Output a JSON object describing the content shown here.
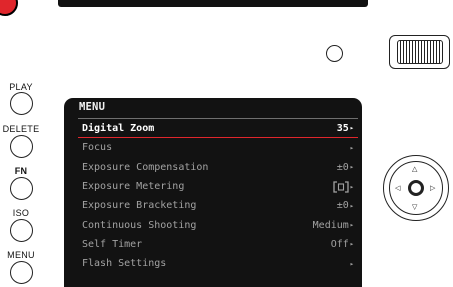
{
  "side_buttons": [
    {
      "label": "PLAY"
    },
    {
      "label": "DELETE"
    },
    {
      "label": "FN"
    },
    {
      "label": "ISO"
    },
    {
      "label": "MENU"
    }
  ],
  "menu": {
    "title": "MENU",
    "items": [
      {
        "label": "Digital Zoom",
        "value": "35",
        "selected": true
      },
      {
        "label": "Focus",
        "value": ""
      },
      {
        "label": "Exposure Compensation",
        "value": "±0"
      },
      {
        "label": "Exposure Metering",
        "value": "",
        "value_icon": "center-weighted-metering-icon"
      },
      {
        "label": "Exposure Bracketing",
        "value": "±0"
      },
      {
        "label": "Continuous Shooting",
        "value": "Medium"
      },
      {
        "label": "Self Timer",
        "value": "Off"
      },
      {
        "label": "Flash Settings",
        "value": ""
      }
    ]
  },
  "colors": {
    "accent_red": "#e0262c",
    "screen_bg": "#121212",
    "selected_text": "#ffffff",
    "item_text": "#a2a2a2"
  }
}
